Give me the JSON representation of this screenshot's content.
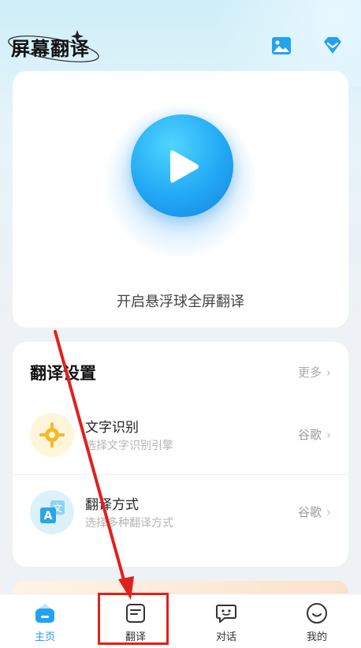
{
  "header": {
    "title": "屏幕翻译",
    "image_icon": "image-icon",
    "vip_icon": "diamond-icon"
  },
  "main": {
    "float_label": "开启悬浮球全屏翻译",
    "play_icon": "play-icon"
  },
  "settings": {
    "title": "翻译设置",
    "more": "更多",
    "rows": [
      {
        "title": "文字识别",
        "subtitle": "选择文字识别引擎",
        "value": "谷歌",
        "icon": "ocr-target-icon"
      },
      {
        "title": "翻译方式",
        "subtitle": "选择多种翻译方式",
        "value": "谷歌",
        "icon": "translate-icon"
      }
    ]
  },
  "tabs": [
    {
      "label": "主页",
      "icon": "home-icon",
      "active": true
    },
    {
      "label": "翻译",
      "icon": "document-icon",
      "active": false
    },
    {
      "label": "对话",
      "icon": "chat-icon",
      "active": false
    },
    {
      "label": "我的",
      "icon": "smile-icon",
      "active": false
    }
  ],
  "colors": {
    "accent": "#1e9df0",
    "highlight": "#e0211b"
  }
}
